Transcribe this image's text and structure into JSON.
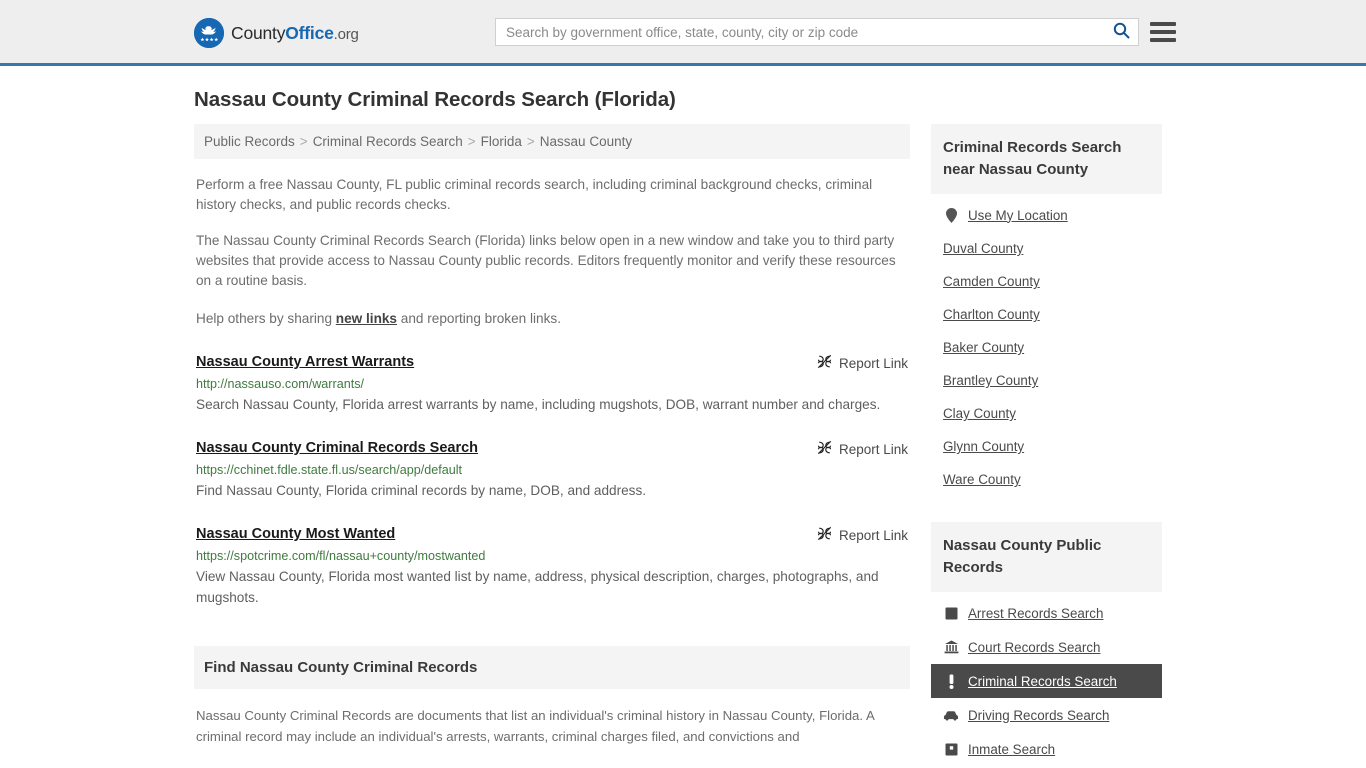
{
  "header": {
    "logo": {
      "name_part1": "County",
      "name_part2": "Office",
      "suffix": ".org",
      "icon": "eagle-seal-icon"
    },
    "search": {
      "placeholder": "Search by government office, state, county, city or zip code",
      "value": "",
      "search_icon": "search-icon"
    },
    "menu_icon": "hamburger-menu-icon"
  },
  "page": {
    "title": "Nassau County Criminal Records Search (Florida)"
  },
  "breadcrumb": {
    "separator": ">",
    "items": [
      {
        "label": "Public Records"
      },
      {
        "label": "Criminal Records Search"
      },
      {
        "label": "Florida"
      },
      {
        "label": "Nassau County"
      }
    ]
  },
  "intro": {
    "p1": "Perform a free Nassau County, FL public criminal records search, including criminal background checks, criminal history checks, and public records checks.",
    "p2": "The Nassau County Criminal Records Search (Florida) links below open in a new window and take you to third party websites that provide access to Nassau County public records. Editors frequently monitor and verify these resources on a routine basis.",
    "p3_before": "Help others by sharing ",
    "p3_link": "new links",
    "p3_after": " and reporting broken links."
  },
  "results": {
    "report_label": "Report Link",
    "report_icon": "broken-link-icon",
    "items": [
      {
        "title": "Nassau County Arrest Warrants",
        "url": "http://nassauso.com/warrants/",
        "description": "Search Nassau County, Florida arrest warrants by name, including mugshots, DOB, warrant number and charges."
      },
      {
        "title": "Nassau County Criminal Records Search",
        "url": "https://cchinet.fdle.state.fl.us/search/app/default",
        "description": "Find Nassau County, Florida criminal records by name, DOB, and address."
      },
      {
        "title": "Nassau County Most Wanted",
        "url": "https://spotcrime.com/fl/nassau+county/mostwanted",
        "description": "View Nassau County, Florida most wanted list by name, address, physical description, charges, photographs, and mugshots."
      }
    ]
  },
  "find_section": {
    "heading": "Find Nassau County Criminal Records",
    "body": "Nassau County Criminal Records are documents that list an individual's criminal history in Nassau County, Florida. A criminal record may include an individual's arrests, warrants, criminal charges filed, and convictions and"
  },
  "sidebar": {
    "nearby": {
      "heading": "Criminal Records Search near Nassau County",
      "use_my_location": {
        "label": "Use My Location",
        "icon": "map-pin-icon"
      },
      "counties": [
        {
          "label": "Duval County"
        },
        {
          "label": "Camden County"
        },
        {
          "label": "Charlton County"
        },
        {
          "label": "Baker County"
        },
        {
          "label": "Brantley County"
        },
        {
          "label": "Clay County"
        },
        {
          "label": "Glynn County"
        },
        {
          "label": "Ware County"
        }
      ]
    },
    "public_records": {
      "heading": "Nassau County Public Records",
      "items": [
        {
          "label": "Arrest Records Search",
          "icon": "fingerprint-icon",
          "active": false
        },
        {
          "label": "Court Records Search",
          "icon": "courthouse-icon",
          "active": false
        },
        {
          "label": "Criminal Records Search",
          "icon": "exclamation-icon",
          "active": true
        },
        {
          "label": "Driving Records Search",
          "icon": "car-icon",
          "active": false
        },
        {
          "label": "Inmate Search",
          "icon": "jail-building-icon",
          "active": false
        }
      ]
    }
  },
  "colors": {
    "brand_blue": "#1668b3",
    "header_border": "#3b78aa",
    "header_bg": "#eeeeee",
    "panel_bg": "#f4f4f4",
    "active_bg": "#4a4a4a",
    "url_green": "#3f7a3f"
  }
}
